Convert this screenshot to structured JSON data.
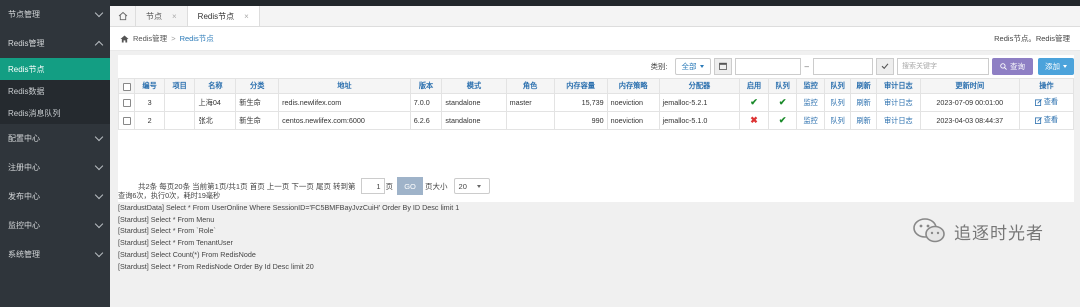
{
  "sidebar": {
    "groups": [
      {
        "label": "节点管理",
        "open": false
      },
      {
        "label": "Redis管理",
        "open": true,
        "items": [
          {
            "label": "Redis节点",
            "active": true
          },
          {
            "label": "Redis数据",
            "active": false
          },
          {
            "label": "Redis消息队列",
            "active": false
          }
        ]
      },
      {
        "label": "配置中心",
        "open": false
      },
      {
        "label": "注册中心",
        "open": false
      },
      {
        "label": "发布中心",
        "open": false
      },
      {
        "label": "监控中心",
        "open": false
      },
      {
        "label": "系统管理",
        "open": false
      }
    ]
  },
  "tabs": [
    {
      "label": "节点",
      "close": "×",
      "active": false
    },
    {
      "label": "Redis节点",
      "close": "×",
      "active": true
    }
  ],
  "breadcrumb": {
    "root": "Redis管理",
    "sep": ">",
    "current": "Redis节点"
  },
  "header_right": "Redis节点。Redis管理",
  "search": {
    "category_label": "类别:",
    "category_value": "全部",
    "date_sep": "–",
    "keyword_placeholder": "搜索关键字",
    "query_label": "查询",
    "add_label": "添加"
  },
  "table": {
    "headers": [
      "编号",
      "项目",
      "名称",
      "分类",
      "地址",
      "版本",
      "模式",
      "角色",
      "内存容量",
      "内存策略",
      "分配器",
      "启用",
      "队列",
      "监控",
      "队列",
      "刷新",
      "审计日志",
      "更新时间",
      "操作"
    ],
    "rows": [
      {
        "id": "3",
        "project": "",
        "name": "上海04",
        "category": "新生命",
        "address": "redis.newlifex.com",
        "version": "7.0.0",
        "mode": "standalone",
        "role": "master",
        "memory": "15,739",
        "policy": "noeviction",
        "allocator": "jemalloc-5.2.1",
        "enabled": true,
        "queue_on": true,
        "monitor": "监控",
        "queue": "队列",
        "refresh": "刷新",
        "audit": "审计日志",
        "updated": "2023-07-09 00:01:00",
        "action": "查看"
      },
      {
        "id": "2",
        "project": "",
        "name": "张北",
        "category": "新生命",
        "address": "centos.newlifex.com:6000",
        "version": "6.2.6",
        "mode": "standalone",
        "role": "",
        "memory": "990",
        "policy": "noeviction",
        "allocator": "jemalloc-5.1.0",
        "enabled": false,
        "queue_on": true,
        "monitor": "监控",
        "queue": "队列",
        "refresh": "刷新",
        "audit": "审计日志",
        "updated": "2023-04-03 08:44:37",
        "action": "查看"
      }
    ]
  },
  "pager": {
    "summary": "共2条 每页20条 当前第1页/共1页 首页 上一页 下一页 尾页 转到第",
    "page_input": "1",
    "page_unit": "页",
    "go": "GO",
    "size_label": "页大小",
    "size_value": "20"
  },
  "log": [
    "查询6次，执行0次，耗时19毫秒",
    "[StardustData] Select * From UserOnline Where SessionID='FC5BMFBayJvzCuiH' Order By ID Desc limit 1",
    "[Stardust] Select * From Menu",
    "[Stardust] Select * From `Role`",
    "[Stardust] Select * From TenantUser",
    "[Stardust] Select Count(*) From RedisNode",
    "[Stardust] Select * From RedisNode Order By Id Desc limit 20"
  ],
  "watermark": "追逐时光者",
  "colors": {
    "sidebar": "#2f353b",
    "active": "#139e83",
    "link": "#2a6fae",
    "query": "#8e7fc4",
    "add": "#4ca3db"
  }
}
